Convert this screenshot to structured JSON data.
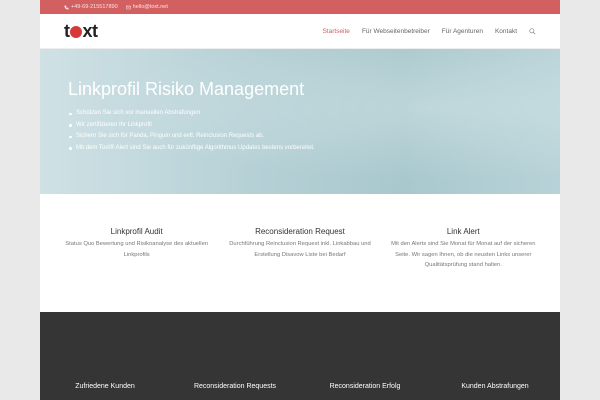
{
  "topbar": {
    "phone": "+49-69-215517890",
    "email": "hello@toxt.net"
  },
  "header": {
    "logo_prefix": "t",
    "logo_suffix": "xt",
    "nav": [
      {
        "label": "Startseite",
        "active": true
      },
      {
        "label": "Für Webseitenbetreiber",
        "active": false
      },
      {
        "label": "Für Agenturen",
        "active": false
      },
      {
        "label": "Kontakt",
        "active": false
      }
    ],
    "search_icon": "search-icon"
  },
  "hero": {
    "title": "Linkprofil Risiko Management",
    "bullets": [
      "Schützen Sie sich vor manuellen Abstrafungen",
      "Wir zertifizieren Ihr Linkprofil",
      "Sichern Sie sich für Panda, Pinguin und evtl. Reinclusion Requests ab.",
      "Mit dem Toxt® Alert sind Sie auch für zukünftige Algorithmus Updates bestens vorbereitet."
    ]
  },
  "features": [
    {
      "title": "Linkprofil Audit",
      "text": "Status Quo Bewertung und Risikoanalyse des aktuellen Linkprofils"
    },
    {
      "title": "Reconsideration Request",
      "text": "Durchführung Reinclusion Request inkl. Linkabbau und Erstellung Disavow Liste bei Bedarf"
    },
    {
      "title": "Link Alert",
      "text": "Mit den Alerts sind Sie Monat für Monat auf der sicheren Seite. Wir sagen Ihnen, ob die neusten Links unserer Qualitätsprüfung stand halten."
    }
  ],
  "stats": [
    {
      "label": "Zufriedene Kunden"
    },
    {
      "label": "Reconsideration Requests"
    },
    {
      "label": "Reconsideration Erfolg"
    },
    {
      "label": "Kunden Abstrafungen"
    }
  ],
  "colors": {
    "accent": "#d36060",
    "logo_red": "#d93838",
    "dark_bg": "#353535"
  }
}
